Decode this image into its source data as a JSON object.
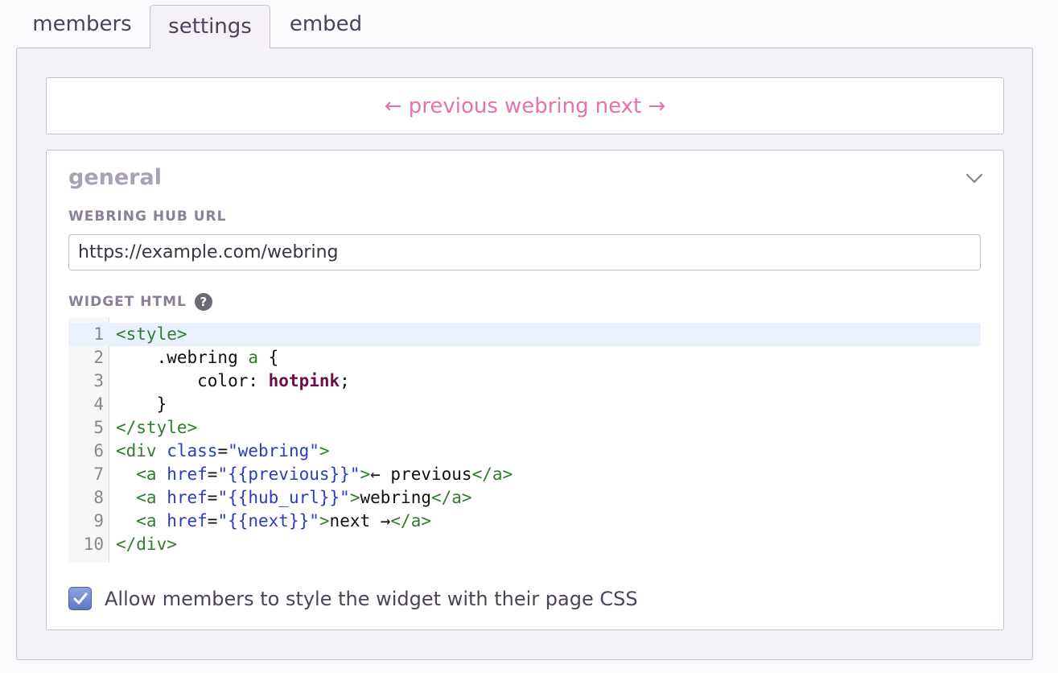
{
  "tabs": [
    {
      "label": "members"
    },
    {
      "label": "settings",
      "active": true
    },
    {
      "label": "embed"
    }
  ],
  "preview": {
    "prev": "← previous",
    "hub": "webring",
    "next": "next →",
    "link_color": "#e472ae"
  },
  "general": {
    "title": "general",
    "hub_url_label": "WEBRING HUB URL",
    "hub_url_value": "https://example.com/webring",
    "widget_html_label": "WIDGET HTML",
    "help_glyph": "?",
    "icons": [
      "chevron-down-icon",
      "help-icon",
      "check-icon"
    ]
  },
  "editor": {
    "active_line": 1,
    "lines": [
      {
        "n": "1",
        "tokens": [
          [
            "tag",
            "<style>"
          ]
        ]
      },
      {
        "n": "2",
        "tokens": [
          [
            "prop",
            "    .webring "
          ],
          [
            "tag",
            "a"
          ],
          [
            "prop",
            " {"
          ]
        ]
      },
      {
        "n": "3",
        "tokens": [
          [
            "prop",
            "        color: "
          ],
          [
            "kw",
            "hotpink"
          ],
          [
            "prop",
            ";"
          ]
        ]
      },
      {
        "n": "4",
        "tokens": [
          [
            "prop",
            "    }"
          ]
        ]
      },
      {
        "n": "5",
        "tokens": [
          [
            "tag",
            "</style>"
          ]
        ]
      },
      {
        "n": "6",
        "tokens": [
          [
            "tag",
            "<div "
          ],
          [
            "attr",
            "class"
          ],
          [
            "prop",
            "="
          ],
          [
            "str",
            "\"webring\""
          ],
          [
            "tag",
            ">"
          ]
        ]
      },
      {
        "n": "7",
        "tokens": [
          [
            "tag",
            "  <a "
          ],
          [
            "attr",
            "href"
          ],
          [
            "prop",
            "="
          ],
          [
            "str",
            "\"{{previous}}\""
          ],
          [
            "tag",
            ">"
          ],
          [
            "prop",
            "← previous"
          ],
          [
            "tag",
            "</a>"
          ]
        ]
      },
      {
        "n": "8",
        "tokens": [
          [
            "tag",
            "  <a "
          ],
          [
            "attr",
            "href"
          ],
          [
            "prop",
            "="
          ],
          [
            "str",
            "\"{{hub_url}}\""
          ],
          [
            "tag",
            ">"
          ],
          [
            "prop",
            "webring"
          ],
          [
            "tag",
            "</a>"
          ]
        ]
      },
      {
        "n": "9",
        "tokens": [
          [
            "tag",
            "  <a "
          ],
          [
            "attr",
            "href"
          ],
          [
            "prop",
            "="
          ],
          [
            "str",
            "\"{{next}}\""
          ],
          [
            "tag",
            ">"
          ],
          [
            "prop",
            "next →"
          ],
          [
            "tag",
            "</a>"
          ]
        ]
      },
      {
        "n": "10",
        "tokens": [
          [
            "tag",
            "</div>"
          ]
        ]
      }
    ]
  },
  "allow_css": {
    "label": "Allow members to style the widget with their page CSS",
    "checked": true
  }
}
